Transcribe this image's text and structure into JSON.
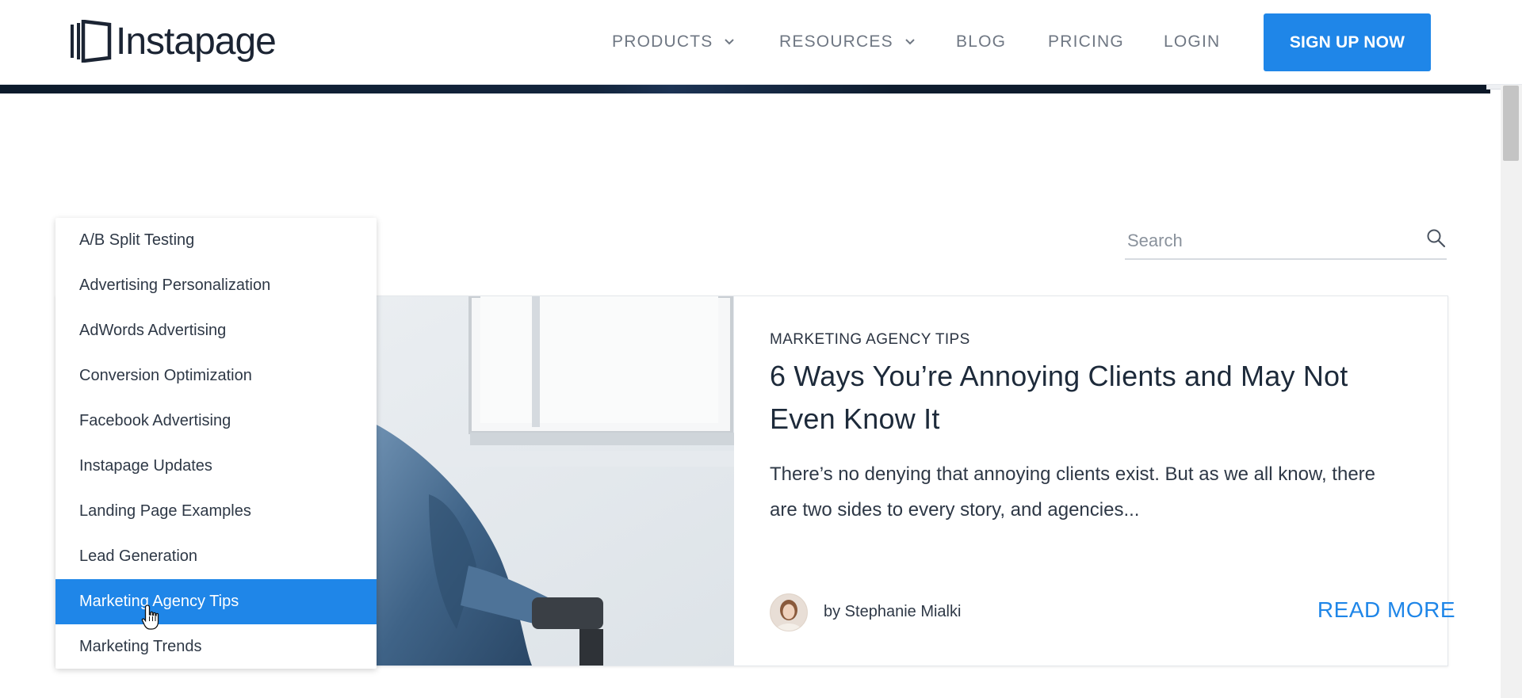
{
  "header": {
    "logo_text": "Instapage",
    "nav": [
      {
        "label": "PRODUCTS",
        "has_dropdown": true
      },
      {
        "label": "RESOURCES",
        "has_dropdown": true
      },
      {
        "label": "BLOG",
        "has_dropdown": false
      },
      {
        "label": "PRICING",
        "has_dropdown": false
      },
      {
        "label": "LOGIN",
        "has_dropdown": false
      }
    ],
    "signup_label": "SIGN UP NOW"
  },
  "search": {
    "placeholder": "Search",
    "icon": "search-icon"
  },
  "category_dropdown": {
    "items": [
      "A/B Split Testing",
      "Advertising Personalization",
      "AdWords Advertising",
      "Conversion Optimization",
      "Facebook Advertising",
      "Instapage Updates",
      "Landing Page Examples",
      "Lead Generation",
      "Marketing Agency Tips",
      "Marketing Trends"
    ],
    "highlighted": "Marketing Agency Tips"
  },
  "post": {
    "category": "MARKETING AGENCY TIPS",
    "title": "6 Ways You’re Annoying Clients and May Not Even Know It",
    "excerpt": "There’s no denying that annoying clients exist. But as we all know, there are two sides to every story, and agencies...",
    "author": "by Stephanie Mialki",
    "read_more": "READ MORE"
  },
  "colors": {
    "accent": "#1f86e8",
    "nav_text": "#6f7783",
    "dark_text": "#1d2a3a"
  }
}
